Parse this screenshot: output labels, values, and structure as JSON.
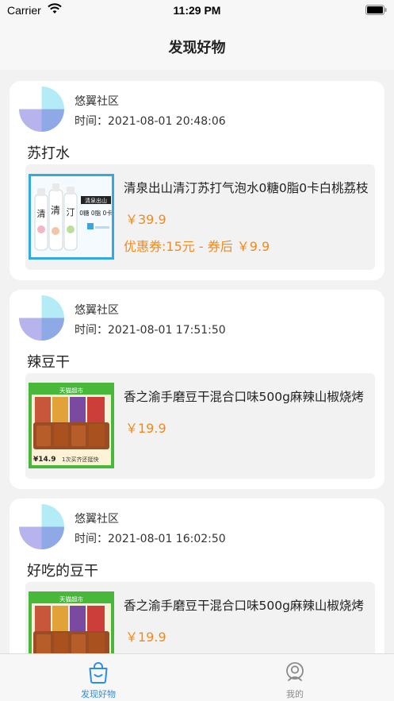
{
  "status_bar": {
    "carrier": "Carrier",
    "time": "11:29 PM"
  },
  "nav": {
    "title": "发现好物"
  },
  "posts": [
    {
      "author": "悠翼社区",
      "time_label": "时间：",
      "time": "2021-08-01 20:48:06",
      "title": "苏打水",
      "product": {
        "name": "清泉出山清汀苏打气泡水0糖0脂0卡白桃荔枝",
        "price": "￥39.9",
        "coupon": "优惠券:15元 - 券后 ￥9.9",
        "image_icon": "soda-water-bottles-image",
        "image_text": {
          "tag": "清泉出山",
          "slogan": "0糖 0脂 0卡"
        }
      }
    },
    {
      "author": "悠翼社区",
      "time_label": "时间：",
      "time": "2021-08-01 17:51:50",
      "title": "辣豆干",
      "product": {
        "name": "香之渝手磨豆干混合口味500g麻辣山椒烧烤",
        "price": "￥19.9",
        "image_icon": "dried-tofu-snack-image",
        "image_text": {
          "store": "天猫超市",
          "promo_price": "¥14.9",
          "promo": "1次买齐还挺快"
        }
      }
    },
    {
      "author": "悠翼社区",
      "time_label": "时间：",
      "time": "2021-08-01 16:02:50",
      "title": "好吃的豆干",
      "product": {
        "name": "香之渝手磨豆干混合口味500g麻辣山椒烧烤",
        "price": "￥19.9",
        "image_icon": "dried-tofu-snack-image",
        "image_text": {
          "store": "天猫超市"
        }
      }
    }
  ],
  "tabs": [
    {
      "label": "发现好物",
      "icon": "shopping-bag-icon",
      "active": true
    },
    {
      "label": "我的",
      "icon": "profile-icon",
      "active": false
    }
  ],
  "colors": {
    "accent": "#2b8ee8",
    "price": "#f08a1c",
    "avatar_cyan": "#b3ecf6",
    "avatar_blue": "#8fa8e6",
    "avatar_purple": "#b7b3ec"
  }
}
